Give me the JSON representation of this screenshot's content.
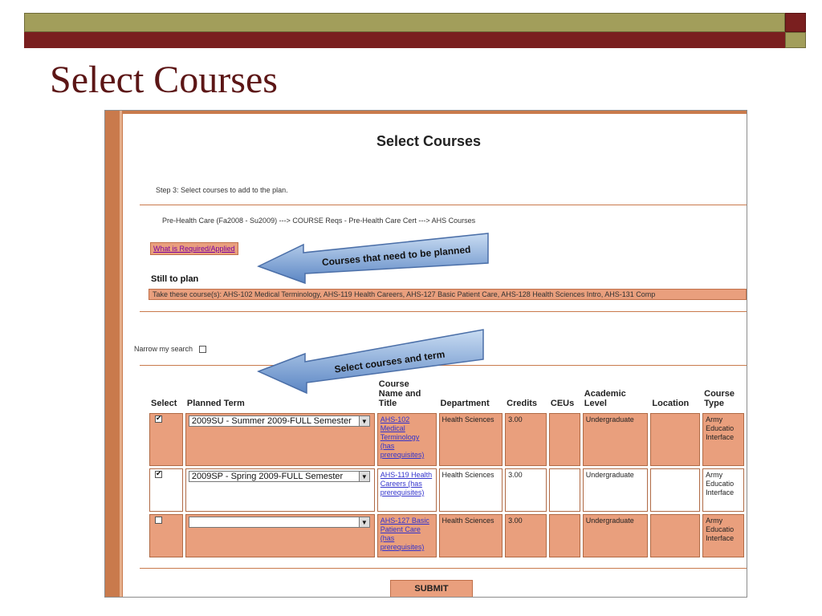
{
  "slide": {
    "title": "Select Courses"
  },
  "page": {
    "heading": "Select Courses",
    "step_text": "Step 3: Select courses to add to the plan.",
    "path_text": "Pre-Health Care (Fa2008 - Su2009) ---> COURSE Reqs - Pre-Health Care Cert ---> AHS Courses",
    "required_link": "What is Required/Applied",
    "still_label": "Still to plan",
    "still_text": "Take these course(s): AHS-102 Medical Terminology, AHS-119 Health Careers, AHS-127 Basic Patient Care, AHS-128 Health Sciences Intro, AHS-131 Comp",
    "narrow_label": "Narrow my search",
    "submit_label": "SUBMIT"
  },
  "annotations": {
    "arrow1": "Courses that need to be planned",
    "arrow2": "Select courses and term"
  },
  "table": {
    "headers": [
      "Select",
      "Planned Term",
      "Course Name and Title",
      "Department",
      "Credits",
      "CEUs",
      "Academic Level",
      "Location",
      "Course Type"
    ],
    "rows": [
      {
        "checked": true,
        "term": "2009SU - Summer 2009-FULL Semester",
        "course": "AHS-102 Medical Terminology (has prerequisites)",
        "department": "Health Sciences",
        "credits": "3.00",
        "ceus": "",
        "level": "Undergraduate",
        "location": "",
        "type": "Army Educatio Interface"
      },
      {
        "checked": true,
        "term": "2009SP - Spring 2009-FULL Semester",
        "course": "AHS-119 Health Careers (has prerequisites)",
        "department": "Health Sciences",
        "credits": "3.00",
        "ceus": "",
        "level": "Undergraduate",
        "location": "",
        "type": "Army Educatio Interface"
      },
      {
        "checked": false,
        "term": "",
        "course": "AHS-127 Basic Patient Care (has prerequisites)",
        "department": "Health Sciences",
        "credits": "3.00",
        "ceus": "",
        "level": "Undergraduate",
        "location": "",
        "type": "Army Educatio Interface"
      }
    ]
  }
}
